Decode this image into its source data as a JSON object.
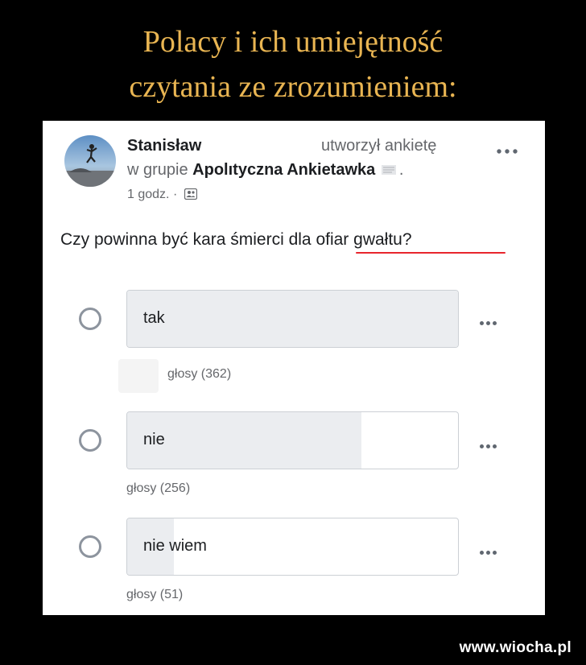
{
  "meme": {
    "title_line1": "Polacy i ich umiejętność",
    "title_line2": "czytania ze zrozumieniem:"
  },
  "post": {
    "author": "Stanisław",
    "action": "utworzył ankietę",
    "group_prefix": "w grupie",
    "group_name": "Apolıtyczna Ankietawka",
    "group_suffix": ".",
    "time": "1 godz.",
    "time_separator": "·",
    "audience_icon": "group-audience-icon",
    "more_icon": "more-horizontal-icon"
  },
  "poll": {
    "question": "Czy powinna być kara śmierci dla ofiar gwałtu?",
    "highlight_color": "#e8262d",
    "options": [
      {
        "label": "tak",
        "votes_text": "głosy (362)",
        "share": 1.0
      },
      {
        "label": "nie",
        "votes_text": "głosy (256)",
        "share": 0.707
      },
      {
        "label": "nie wiem",
        "votes_text": "głosy (51)",
        "share": 0.141
      }
    ]
  },
  "watermark": "www.wiocha.pl",
  "colors": {
    "title": "#e9b552",
    "background": "#000000",
    "bar_fill": "#ebedf0"
  }
}
